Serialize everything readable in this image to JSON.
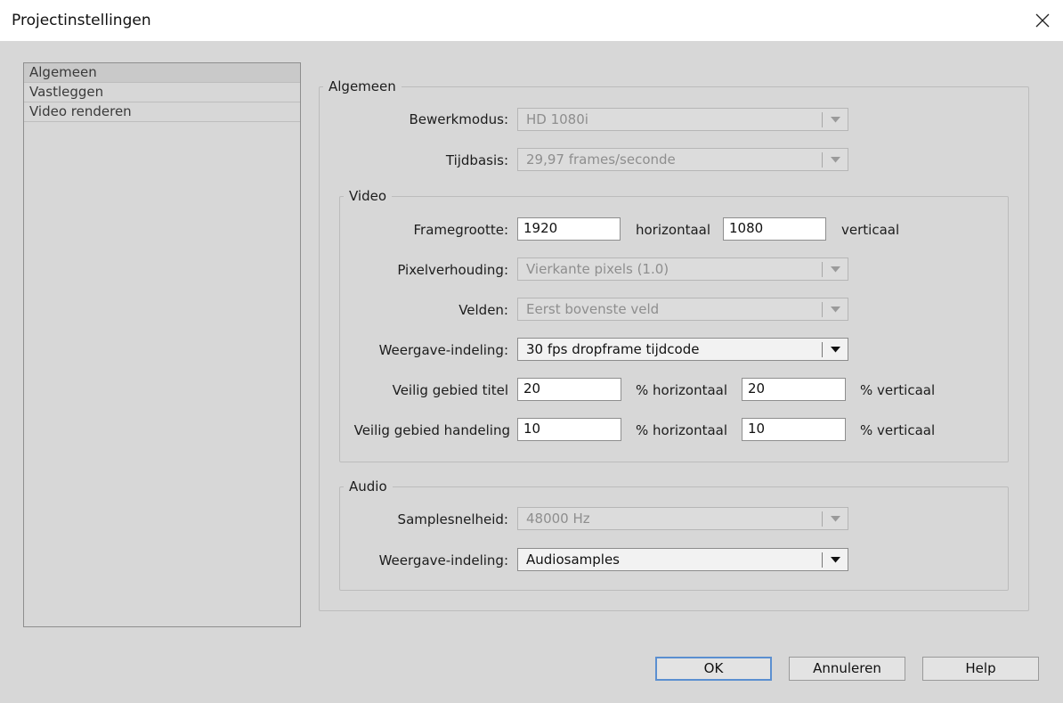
{
  "window": {
    "title": "Projectinstellingen"
  },
  "sidebar": {
    "items": [
      {
        "label": "Algemeen",
        "selected": true
      },
      {
        "label": "Vastleggen"
      },
      {
        "label": "Video renderen"
      }
    ]
  },
  "general": {
    "legend": "Algemeen",
    "edit_mode": {
      "label": "Bewerkmodus:",
      "value": "HD 1080i",
      "enabled": false
    },
    "timebase": {
      "label": "Tijdbasis:",
      "value": "29,97 frames/seconde",
      "enabled": false
    }
  },
  "video": {
    "legend": "Video",
    "frame_size": {
      "label": "Framegrootte:",
      "horizontal": "1920",
      "horizontal_unit": "horizontaal",
      "vertical": "1080",
      "vertical_unit": "verticaal"
    },
    "pixel_aspect": {
      "label": "Pixelverhouding:",
      "value": "Vierkante pixels (1.0)",
      "enabled": false
    },
    "fields": {
      "label": "Velden:",
      "value": "Eerst bovenste veld",
      "enabled": false
    },
    "display_format": {
      "label": "Weergave-indeling:",
      "value": "30 fps dropframe tijdcode",
      "enabled": true
    },
    "title_safe": {
      "label": "Veilig gebied titel",
      "horizontal": "20",
      "horizontal_unit": "% horizontaal",
      "vertical": "20",
      "vertical_unit": "% verticaal"
    },
    "action_safe": {
      "label": "Veilig gebied handeling",
      "horizontal": "10",
      "horizontal_unit": "% horizontaal",
      "vertical": "10",
      "vertical_unit": "% verticaal"
    }
  },
  "audio": {
    "legend": "Audio",
    "sample_rate": {
      "label": "Samplesnelheid:",
      "value": "48000 Hz",
      "enabled": false
    },
    "display_format": {
      "label": "Weergave-indeling:",
      "value": "Audiosamples",
      "enabled": true
    }
  },
  "buttons": {
    "ok": "OK",
    "cancel": "Annuleren",
    "help": "Help"
  },
  "colors": {
    "dialog_bg": "#d7d7d7",
    "titlebar_bg": "#ffffff",
    "default_button_border": "#5b8fd0",
    "disabled_text": "#8e8e8e"
  }
}
